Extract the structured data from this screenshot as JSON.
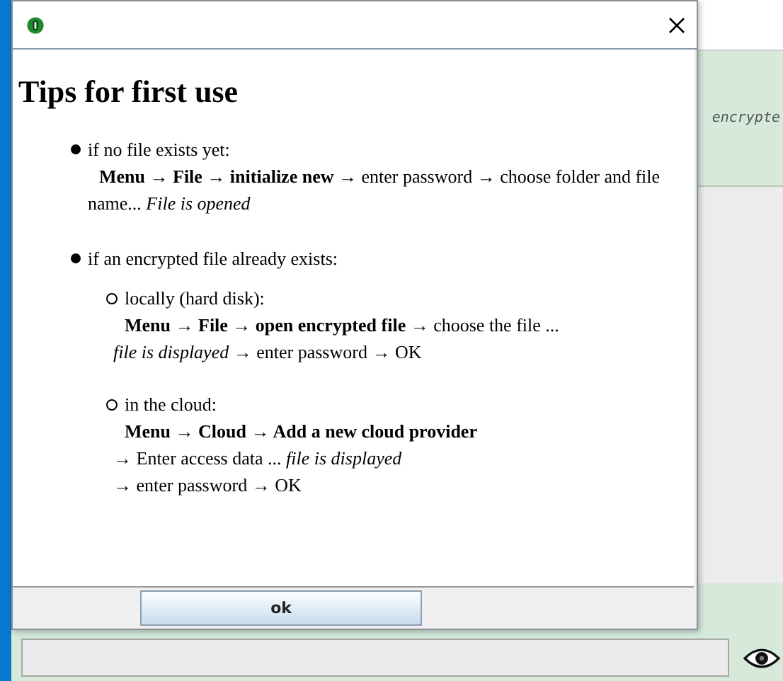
{
  "background_window": {
    "status_text": "encrypte"
  },
  "dialog": {
    "heading": "Tips for first use",
    "sections": [
      {
        "label": "if no file exists yet:",
        "lines": [
          "**Menu → File → initialize new** → enter password → choose folder and file name... *File is opened*"
        ]
      },
      {
        "label": "if an encrypted file already exists:",
        "children": [
          {
            "label": "locally (hard disk):",
            "lines": [
              "**Menu → File → open encrypted file** → choose the file ...",
              "*file is displayed* → enter password → OK"
            ]
          },
          {
            "label": "in the cloud:",
            "lines": [
              "**Menu → Cloud → Add a new cloud provider**",
              "→ Enter access data ... *file is displayed*",
              "→ enter password → OK"
            ]
          }
        ]
      }
    ],
    "buttons": [
      {
        "label": "ok"
      }
    ]
  }
}
